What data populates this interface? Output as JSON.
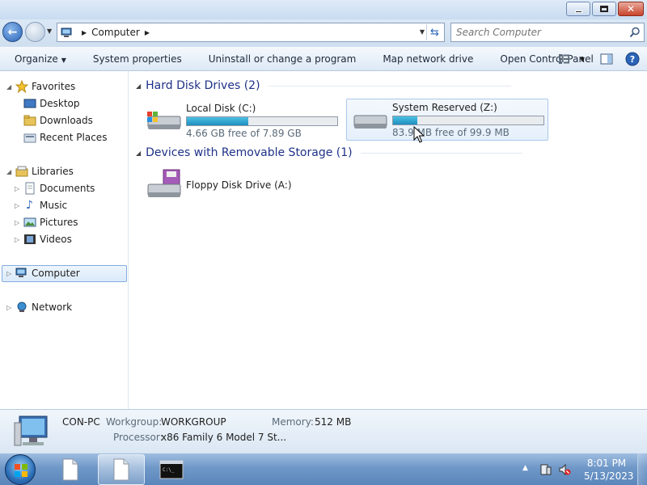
{
  "window": {
    "controls": {
      "minimize": "minimize",
      "maximize": "maximize",
      "close": "close"
    }
  },
  "address": {
    "path": "Computer",
    "search_placeholder": "Search Computer"
  },
  "toolbar": {
    "organize": "Organize",
    "system_properties": "System properties",
    "uninstall": "Uninstall or change a program",
    "map_network": "Map network drive",
    "control_panel": "Open Control Panel"
  },
  "nav": {
    "favorites": "Favorites",
    "desktop": "Desktop",
    "downloads": "Downloads",
    "recent": "Recent Places",
    "libraries": "Libraries",
    "documents": "Documents",
    "music": "Music",
    "pictures": "Pictures",
    "videos": "Videos",
    "computer": "Computer",
    "network": "Network"
  },
  "content": {
    "hdd_group": "Hard Disk Drives (2)",
    "removable_group": "Devices with Removable Storage (1)",
    "drives": [
      {
        "name": "Local Disk (C:)",
        "free": "4.66 GB free of 7.89 GB",
        "used_fraction": 0.41
      },
      {
        "name": "System Reserved (Z:)",
        "free": "83.9 MB free of 99.9 MB",
        "used_fraction": 0.16
      }
    ],
    "floppy": "Floppy Disk Drive (A:)"
  },
  "details": {
    "computer_name": "CON-PC",
    "workgroup_label": "Workgroup:",
    "workgroup": "WORKGROUP",
    "memory_label": "Memory:",
    "memory": "512 MB",
    "processor_label": "Processor:",
    "processor": "x86 Family 6 Model 7 St..."
  },
  "taskbar": {
    "time": "8:01 PM",
    "date": "5/13/2023"
  },
  "colors": {
    "accent": "#1e3287",
    "bar_fill": "#1f8fc0",
    "selection": "#84acdd"
  }
}
